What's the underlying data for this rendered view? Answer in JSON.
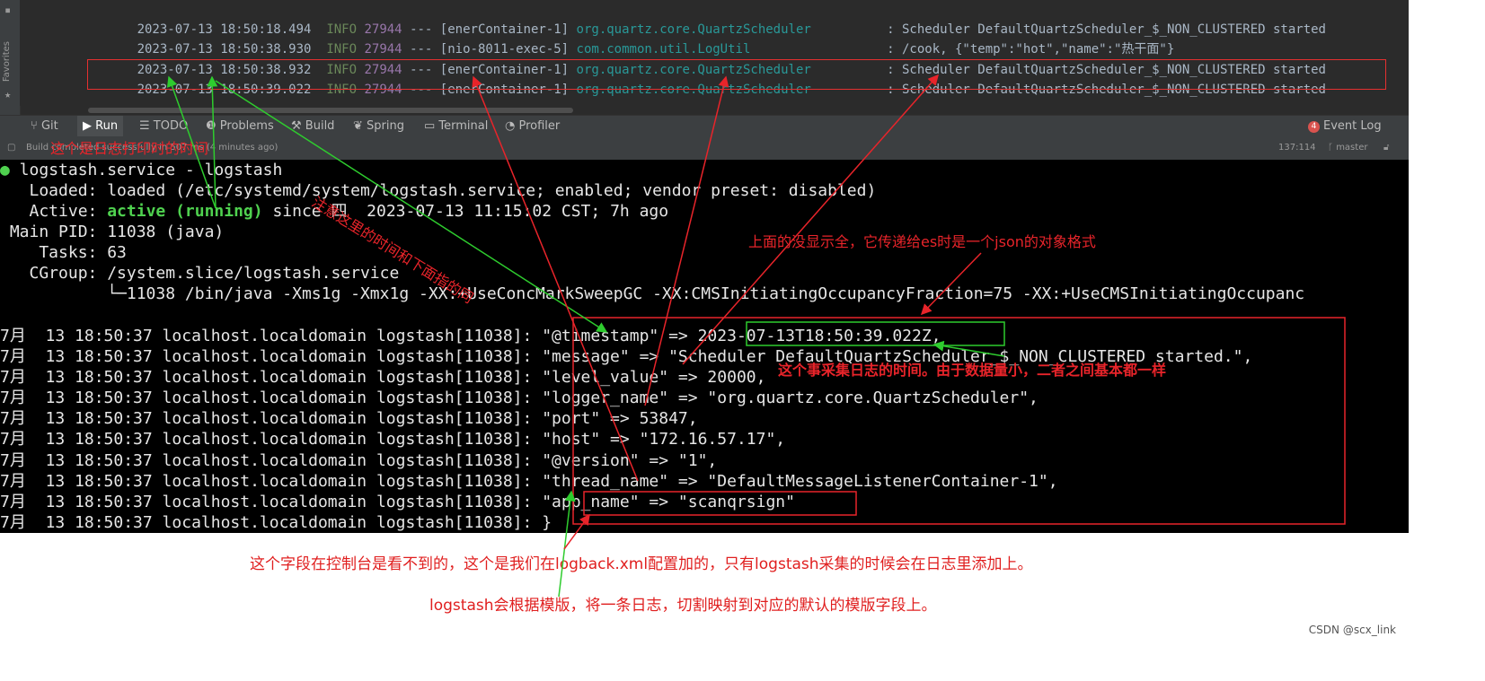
{
  "ide": {
    "favorites_label": "Favorites",
    "log_lines": [
      {
        "ts": "2023-07-13 18:50:18.494",
        "level": "INFO",
        "pid": "27944",
        "sep": "---",
        "thread": "[enerContainer-1]",
        "logger": "org.quartz.core.QuartzScheduler",
        "msg": ": Scheduler DefaultQuartzScheduler_$_NON_CLUSTERED started"
      },
      {
        "ts": "2023-07-13 18:50:38.930",
        "level": "INFO",
        "pid": "27944",
        "sep": "---",
        "thread": "[nio-8011-exec-5]",
        "logger": "com.common.util.LogUtil",
        "msg": ": /cook, {\"temp\":\"hot\",\"name\":\"热干面\"}"
      },
      {
        "ts": "2023-07-13 18:50:38.932",
        "level": "INFO",
        "pid": "27944",
        "sep": "---",
        "thread": "[enerContainer-1]",
        "logger": "org.quartz.core.QuartzScheduler",
        "msg": ": Scheduler DefaultQuartzScheduler_$_NON_CLUSTERED started"
      },
      {
        "ts": "2023-07-13 18:50:39.022",
        "level": "INFO",
        "pid": "27944",
        "sep": "---",
        "thread": "[enerContainer-1]",
        "logger": "org.quartz.core.QuartzScheduler",
        "msg": ": Scheduler DefaultQuartzScheduler_$_NON_CLUSTERED started"
      }
    ],
    "tool_tabs": [
      {
        "icon": "git-icon",
        "label": "Git"
      },
      {
        "icon": "run-icon",
        "label": "Run"
      },
      {
        "icon": "todo-icon",
        "label": "TODO"
      },
      {
        "icon": "problems-icon",
        "label": "Problems"
      },
      {
        "icon": "build-icon",
        "label": "Build"
      },
      {
        "icon": "spring-icon",
        "label": "Spring"
      },
      {
        "icon": "terminal-icon",
        "label": "Terminal"
      },
      {
        "icon": "profiler-icon",
        "label": "Profiler"
      }
    ],
    "event_log": {
      "count": "4",
      "label": "Event Log"
    },
    "status": {
      "build_message": "Build completed successfully in 507 ms (4 minutes ago)",
      "position": "137:114",
      "branch": "master"
    }
  },
  "terminal": {
    "service_bullet": "●",
    "service_line": " logstash.service - logstash",
    "loaded_line": "   Loaded: loaded (/etc/systemd/system/logstash.service; enabled; vendor preset: disabled)",
    "active_prefix": "   Active: ",
    "active_state": "active (running)",
    "active_suffix": " since 四  2023-07-13 11:15:02 CST; 7h ago",
    "pid_line": " Main PID: 11038 (java)",
    "tasks_line": "    Tasks: 63",
    "cgroup_line": "   CGroup: /system.slice/logstash.service",
    "cgroup_proc_line": "           └─11038 /bin/java -Xms1g -Xmx1g -XX:+UseConcMarkSweepGC -XX:CMSInitiatingOccupancyFraction=75 -XX:+UseCMSInitiatingOccupanc",
    "log_prefix": "7月  13 18:50:37 localhost.localdomain logstash[11038]: ",
    "fields": [
      "\"@timestamp\" => 2023-07-13T18:50:39.022Z,",
      "\"message\" => \"Scheduler DefaultQuartzScheduler_$_NON_CLUSTERED started.\",",
      "\"level_value\" => 20000,",
      "\"logger_name\" => \"org.quartz.core.QuartzScheduler\",",
      "\"port\" => 53847,",
      "\"host\" => \"172.16.57.17\",",
      "\"@version\" => \"1\",",
      "\"thread_name\" => \"DefaultMessageListenerContainer-1\",",
      "\"app_name\" => \"scanqrsign\"",
      "}"
    ]
  },
  "annotations": {
    "ann_time_left": "这个是日志打印时的时间",
    "ann_thread_diag": "注意这里的时间和下面指的同",
    "ann_not_shown": "上面的没显示全，它传递给es时是一个json的对象格式",
    "ann_collect_time": "这个事采集日志的时间。由于数据量小，二者之间基本都一样",
    "note_field_invisible": "这个字段在控制台是看不到的，这个是我们在logback.xml配置加的，只有logstash采集的时候会在日志里添加上。",
    "note_template": "logstash会根据模版，将一条日志，切割映射到对应的默认的模版字段上。",
    "watermark": "CSDN @scx_link"
  },
  "colors": {
    "annotation_red": "#e8242a",
    "annotation_green": "#2ecc2e",
    "terminal_green": "#4fd14f",
    "ide_bg": "#2b2b2b"
  }
}
